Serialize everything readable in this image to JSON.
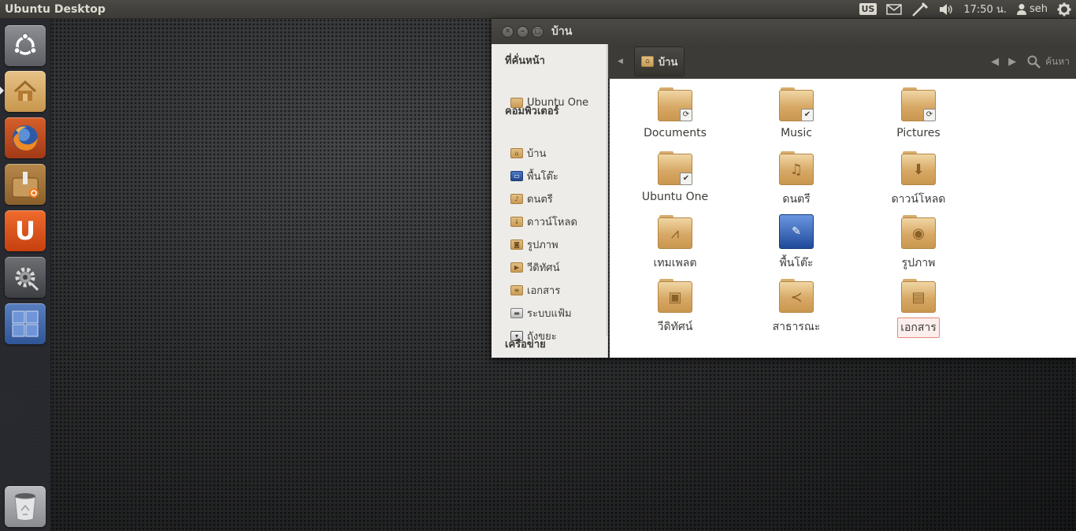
{
  "top_panel": {
    "title": "Ubuntu Desktop",
    "keyboard_layout": "US",
    "clock": "17:50 น.",
    "user": "seh"
  },
  "launcher": {
    "items": [
      {
        "name": "ubuntu-dash",
        "icon": "ubuntu-logo-icon"
      },
      {
        "name": "home-folder",
        "icon": "home-folder-icon",
        "running": true
      },
      {
        "name": "firefox",
        "icon": "firefox-icon"
      },
      {
        "name": "software-center",
        "icon": "software-center-icon"
      },
      {
        "name": "ubuntu-one",
        "icon": "ubuntu-one-icon",
        "glyph": "U"
      },
      {
        "name": "system-settings",
        "icon": "system-settings-icon"
      },
      {
        "name": "workspace-switcher",
        "icon": "workspace-switcher-icon"
      },
      {
        "name": "trash",
        "icon": "trash-icon"
      }
    ]
  },
  "window": {
    "title": "บ้าน",
    "location": "บ้าน",
    "search_label": "ค้นหา"
  },
  "sidebar": {
    "bookmarks_header": "ที่คั่นหน้า",
    "bookmarks": [
      {
        "label": "Ubuntu One"
      }
    ],
    "computer_header": "คอมพิวเตอร์",
    "computer": [
      {
        "label": "บ้าน",
        "icon": "home-icon"
      },
      {
        "label": "พื้นโต๊ะ",
        "icon": "desktop-icon"
      },
      {
        "label": "ดนตรี",
        "icon": "music-folder-icon"
      },
      {
        "label": "ดาวน์โหลด",
        "icon": "download-folder-icon"
      },
      {
        "label": "รูปภาพ",
        "icon": "pictures-folder-icon"
      },
      {
        "label": "วีดิทัศน์",
        "icon": "videos-folder-icon"
      },
      {
        "label": "เอกสาร",
        "icon": "documents-folder-icon"
      },
      {
        "label": "ระบบแฟ้ม",
        "icon": "filesystem-icon"
      },
      {
        "label": "ถังขยะ",
        "icon": "trash-icon"
      }
    ],
    "network_header": "เครือข่าย"
  },
  "files": [
    {
      "label": "Documents",
      "icon": "folder-sync-icon"
    },
    {
      "label": "Music",
      "icon": "folder-synced-icon"
    },
    {
      "label": "Pictures",
      "icon": "folder-sync-icon"
    },
    {
      "label": "Ubuntu One",
      "icon": "folder-synced-icon"
    },
    {
      "label": "ดนตรี",
      "icon": "music-folder-icon"
    },
    {
      "label": "ดาวน์โหลด",
      "icon": "download-folder-icon"
    },
    {
      "label": "เทมเพลต",
      "icon": "templates-folder-icon"
    },
    {
      "label": "พื้นโต๊ะ",
      "icon": "desktop-folder-icon"
    },
    {
      "label": "รูปภาพ",
      "icon": "pictures-folder-icon"
    },
    {
      "label": "วีดิทัศน์",
      "icon": "videos-folder-icon"
    },
    {
      "label": "สาธารณะ",
      "icon": "public-folder-icon"
    },
    {
      "label": "เอกสาร",
      "icon": "documents-folder-icon",
      "selected": true
    }
  ],
  "colors": {
    "panel": "#3c3b37",
    "accent": "#dd4814",
    "folder": "#d7a865"
  }
}
